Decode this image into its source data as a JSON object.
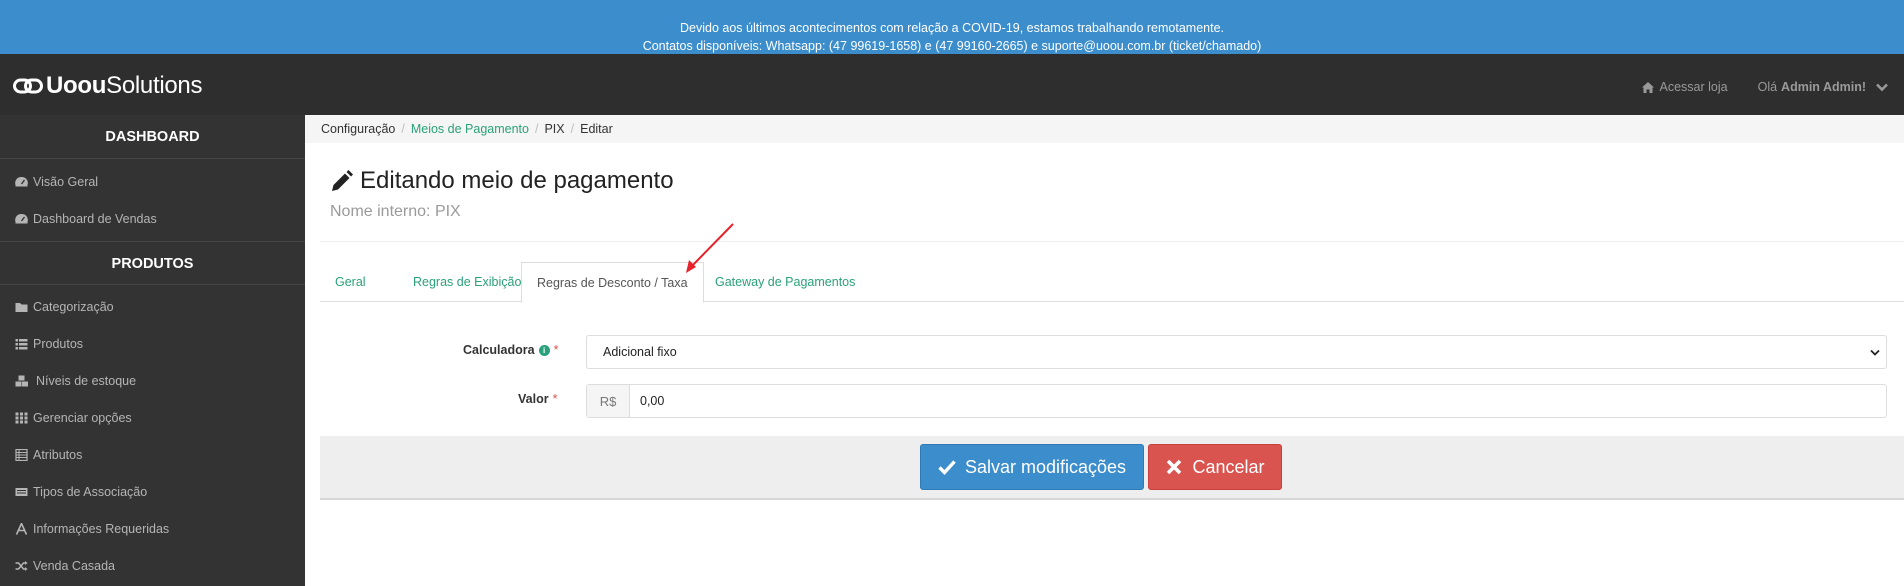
{
  "banner": {
    "line1": "Devido aos últimos acontecimentos com relação a COVID-19, estamos trabalhando remotamente.",
    "line2": "Contatos disponíveis: Whatsapp: (47 99619-1658) e (47 99160-2665) e suporte@uoou.com.br (ticket/chamado)"
  },
  "header": {
    "logo_bold": "Uoou",
    "logo_light": "Solutions",
    "store_link": "Acessar loja",
    "greeting": "Olá",
    "user_name": "Admin Admin!"
  },
  "sidebar": {
    "section1": "DASHBOARD",
    "dashboard_items": [
      {
        "label": "Visão Geral",
        "icon": "dashboard-icon"
      },
      {
        "label": "Dashboard de Vendas",
        "icon": "dashboard-icon"
      }
    ],
    "section2": "PRODUTOS",
    "product_items": [
      {
        "label": "Categorização",
        "icon": "folder-icon"
      },
      {
        "label": "Produtos",
        "icon": "list-icon"
      },
      {
        "label": "Níveis de estoque",
        "icon": "cubes-icon"
      },
      {
        "label": "Gerenciar opções",
        "icon": "grid-icon"
      },
      {
        "label": "Atributos",
        "icon": "table-icon"
      },
      {
        "label": "Tipos de Associação",
        "icon": "tags-icon"
      },
      {
        "label": "Informações Requeridas",
        "icon": "font-icon"
      },
      {
        "label": "Venda Casada",
        "icon": "random-icon"
      }
    ]
  },
  "breadcrumb": {
    "item1": "Configuração",
    "item2": "Meios de Pagamento",
    "item3": "PIX",
    "item4": "Editar",
    "separator": "/"
  },
  "page": {
    "title": "Editando meio de pagamento",
    "subtitle": "Nome interno: PIX"
  },
  "tabs": [
    {
      "label": "Geral"
    },
    {
      "label": "Regras de Exibição"
    },
    {
      "label": "Regras de Desconto / Taxa",
      "active": true
    },
    {
      "label": "Gateway de Pagamentos"
    }
  ],
  "form": {
    "calculator_label": "Calculadora",
    "calculator_value": "Adicional fixo",
    "value_label": "Valor",
    "currency": "R$",
    "value": "0,00",
    "required_mark": "*",
    "info_mark": "i"
  },
  "actions": {
    "save_label": "Salvar modificações",
    "cancel_label": "Cancelar"
  },
  "colors": {
    "banner": "#3c8dcc",
    "header": "#2e2e2e",
    "sidebar": "#333333",
    "accent": "#2aa17a",
    "save": "#3c8dcc",
    "cancel": "#d9534f",
    "annotation": "#e8222a"
  }
}
